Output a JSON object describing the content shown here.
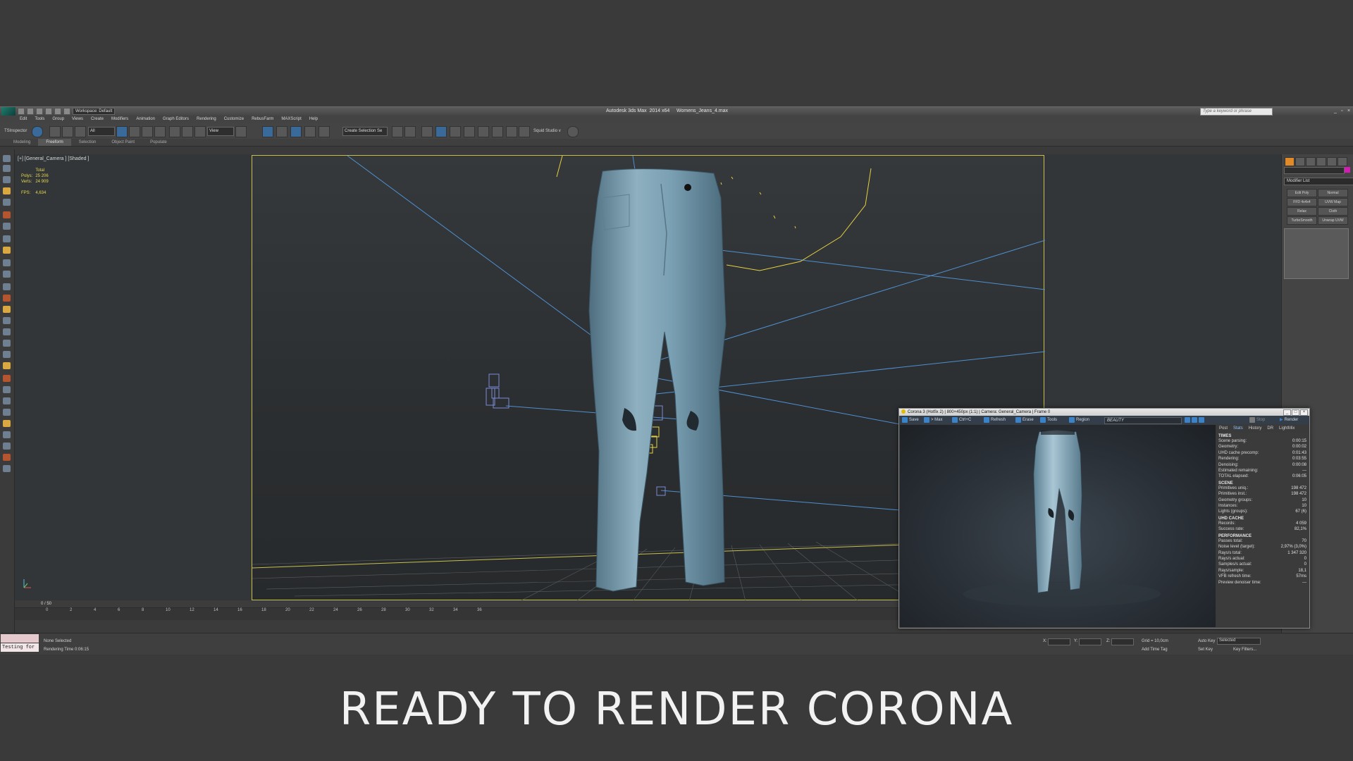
{
  "app": {
    "title": "Autodesk 3ds Max  2014 x64     Womens_Jeans_4.max",
    "workspace": "Workspace: Default",
    "search_placeholder": "Type a keyword or phrase"
  },
  "menu": [
    "Edit",
    "Tools",
    "Group",
    "Views",
    "Create",
    "Modifiers",
    "Animation",
    "Graph Editors",
    "Rendering",
    "Customize",
    "RebusFarm",
    "MAXScript",
    "Help"
  ],
  "toolbar": {
    "inspector": "TSInspector",
    "filter": "All",
    "refcoord": "View",
    "named_selection": "Create Selection Se",
    "studio": "Squid Studio v"
  },
  "ribbon_tabs": [
    "Modeling",
    "Freeform",
    "Selection",
    "Object Paint",
    "Populate"
  ],
  "ribbon_active": "Freeform",
  "viewport": {
    "label": "[+] [General_Camera ] [Shaded ]",
    "stats": {
      "header": "Total",
      "polys_label": "Polys:",
      "polys": "25 206",
      "verts_label": "Verts:",
      "verts": "24 909",
      "fps_label": "FPS:",
      "fps": "4,634"
    }
  },
  "command_panel": {
    "modifier_list": "Modifier List",
    "buttons": [
      "Edit Poly",
      "Normal",
      "FFD 4x4x4",
      "UVW Map",
      "Relax",
      "Cloth",
      "TurboSmooth",
      "Unwrap UVW"
    ]
  },
  "timeline": {
    "frame": "0 / 50",
    "ticks": [
      "0",
      "2",
      "4",
      "6",
      "8",
      "10",
      "12",
      "14",
      "16",
      "18",
      "20",
      "22",
      "24",
      "26",
      "28",
      "30",
      "32",
      "34",
      "36"
    ]
  },
  "status": {
    "maxscript": "Testing for",
    "selection": "None Selected",
    "render_time": "Rendering Time  0:06:15",
    "x_label": "X:",
    "y_label": "Y:",
    "z_label": "Z:",
    "grid": "Grid = 10,0cm",
    "auto_key": "Auto Key",
    "set_key": "Set Key",
    "selected": "Selected",
    "key_filters": "Key Filters...",
    "add_time_tag": "Add Time Tag"
  },
  "vfb": {
    "title": "Corona 3 (Hotfix 2) | 800×450px (1:1) | Camera: General_Camera | Frame 0",
    "toolbar": [
      "Save",
      "> Max",
      "Ctrl+C",
      "Refresh",
      "Erase",
      "Tools",
      "Region"
    ],
    "pass": "BEAUTY",
    "stop": "Stop",
    "render": "Render",
    "tabs": [
      "Post",
      "Stats",
      "History",
      "DR",
      "LightMix"
    ],
    "active_tab": "Stats",
    "sections": [
      {
        "name": "TIMES",
        "rows": [
          [
            "Scene parsing:",
            "0:00:15"
          ],
          [
            "Geometry:",
            "0:00:02"
          ],
          [
            "UHD cache precomp:",
            "0:01:43"
          ],
          [
            "Rendering:",
            "0:03:55"
          ],
          [
            "Denoising:",
            "0:00:08"
          ],
          [
            "Estimated remaining:",
            "---"
          ],
          [
            "TOTAL elapsed:",
            "0:06:05"
          ]
        ]
      },
      {
        "name": "SCENE",
        "rows": [
          [
            "Primitives uniq.:",
            "198 472"
          ],
          [
            "Primitives inst.:",
            "198 472"
          ],
          [
            "Geometry groups:",
            "10"
          ],
          [
            "Instances:",
            "10"
          ],
          [
            "Lights (groups):",
            "67 (6)"
          ]
        ]
      },
      {
        "name": "UHD CACHE",
        "rows": [
          [
            "Records:",
            "4 059"
          ],
          [
            "Success rate:",
            "82,1%"
          ]
        ]
      },
      {
        "name": "PERFORMANCE",
        "rows": [
          [
            "Passes total:",
            "70"
          ],
          [
            "Noise level (target):",
            "2,97% (3,0%)"
          ],
          [
            "Rays/s total:",
            "1 347 320"
          ],
          [
            "Rays/s actual:",
            "0"
          ],
          [
            "Samples/s actual:",
            "0"
          ],
          [
            "Rays/sample:",
            "18,1"
          ],
          [
            "VFB refresh time:",
            "57ms"
          ],
          [
            "Preview denoiser time:",
            "---"
          ]
        ]
      }
    ]
  },
  "caption": "READY TO RENDER  CORONA"
}
